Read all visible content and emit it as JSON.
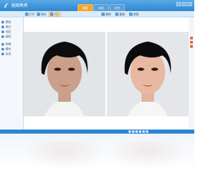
{
  "app": {
    "title": "美图秀秀"
  },
  "tabs": [
    {
      "label": "美容",
      "active": true
    },
    {
      "label": "饰品",
      "active": false
    },
    {
      "label": "文字",
      "active": false
    }
  ],
  "toolbar": {
    "items": [
      {
        "label": "打开",
        "icon": "open-icon"
      },
      {
        "label": "保存",
        "icon": "save-icon"
      },
      {
        "label": "对比",
        "icon": "compare-icon",
        "selected": true
      },
      {
        "label": "撤销",
        "icon": "undo-icon"
      },
      {
        "label": "重做",
        "icon": "redo-icon"
      },
      {
        "label": "原图",
        "icon": "original-icon"
      }
    ]
  },
  "sidebar": {
    "items": [
      {
        "label": "磨皮",
        "icon": "smooth-skin-icon"
      },
      {
        "label": "美白",
        "icon": "whiten-icon"
      },
      {
        "label": "祛痘",
        "icon": "acne-icon"
      },
      {
        "label": "瘦脸",
        "icon": "slim-face-icon"
      },
      {
        "label": "眼睛",
        "icon": "eye-icon"
      },
      {
        "label": "睫毛",
        "icon": "eyelash-icon"
      },
      {
        "label": "染发",
        "icon": "hair-dye-icon"
      }
    ]
  },
  "colors": {
    "titlebar": "#2f86d3",
    "active_tab": "#f5a623",
    "accent": "#e06a3a"
  },
  "photos": [
    {
      "name": "original-photo"
    },
    {
      "name": "retouched-photo"
    }
  ]
}
